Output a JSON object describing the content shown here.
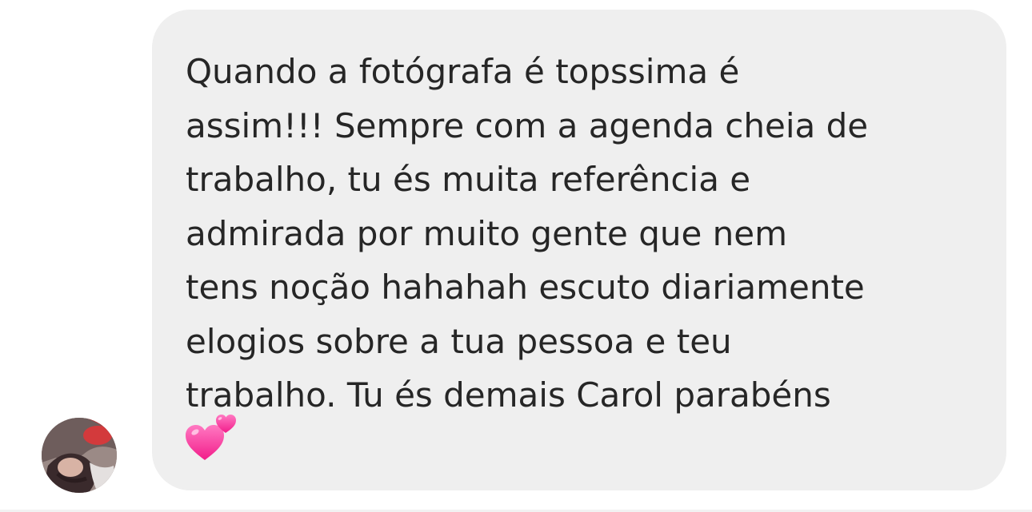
{
  "message": {
    "lines": [
      "Quando a fotógrafa é topssima é",
      "assim!!! Sempre com a agenda cheia de",
      "trabalho, tu és muita referência e",
      "admirada por muito gente que nem",
      "tens noção hahahah escuto diariamente",
      "elogios sobre a tua pessoa e teu",
      "trabalho. Tu és demais Carol parabéns"
    ],
    "emoji": "two-hearts",
    "bubble_color": "#efefef",
    "text_color": "#262626"
  },
  "sender": {
    "avatar_icon": "profile-photo"
  },
  "colors": {
    "heart": "#ff3ea5"
  }
}
